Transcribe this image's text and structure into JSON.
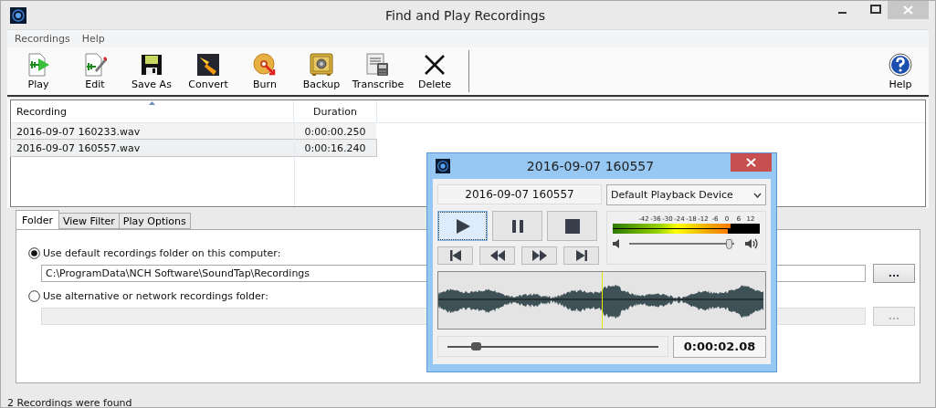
{
  "window": {
    "title": "Find and Play Recordings"
  },
  "menu": [
    {
      "label": "Recordings"
    },
    {
      "label": "Help"
    }
  ],
  "toolbar": [
    {
      "label": "Play"
    },
    {
      "label": "Edit"
    },
    {
      "label": "Save As"
    },
    {
      "label": "Convert"
    },
    {
      "label": "Burn"
    },
    {
      "label": "Backup"
    },
    {
      "label": "Transcribe"
    },
    {
      "label": "Delete"
    }
  ],
  "toolbar_right": {
    "label": "Help"
  },
  "table": {
    "columns": [
      {
        "label": "Recording",
        "sorted": true
      },
      {
        "label": "Duration",
        "sorted": false
      }
    ],
    "rows": [
      {
        "recording": "2016-09-07 160233.wav",
        "duration": "0:00:00.250",
        "selected": false
      },
      {
        "recording": "2016-09-07 160557.wav",
        "duration": "0:00:16.240",
        "selected": true
      }
    ]
  },
  "tabs": [
    {
      "label": "Folder",
      "selected": true
    },
    {
      "label": "View Filter",
      "selected": false
    },
    {
      "label": "Play Options",
      "selected": false
    }
  ],
  "folder_options": [
    {
      "label": "Use default recordings folder on this computer:",
      "selected": true,
      "field": {
        "value": "C:\\ProgramData\\NCH Software\\SoundTap\\Recordings",
        "disabled": false
      },
      "browse": {
        "label": "...",
        "disabled": false
      }
    },
    {
      "label": "Use alternative or network recordings folder:",
      "selected": false,
      "field": {
        "disabled": true
      },
      "browse": {
        "label": "...",
        "disabled": true
      }
    }
  ],
  "status_bar": "2 Recordings were found",
  "player": {
    "title": "2016-09-07 160557",
    "file_name": "2016-09-07 160557",
    "device": "Default Playback Device",
    "meter": {
      "scale": [
        "-42",
        "-36",
        "-30",
        "-24",
        "-18",
        "-12",
        "-6",
        "0",
        "6",
        "12"
      ],
      "channels": [
        {
          "level": 0.8
        },
        {
          "level": 0.78
        }
      ]
    },
    "volume": {
      "level": 0.96
    },
    "playhead": {
      "level": 0.5
    },
    "position": {
      "level": 0.14
    },
    "time": "0:00:02.08"
  }
}
